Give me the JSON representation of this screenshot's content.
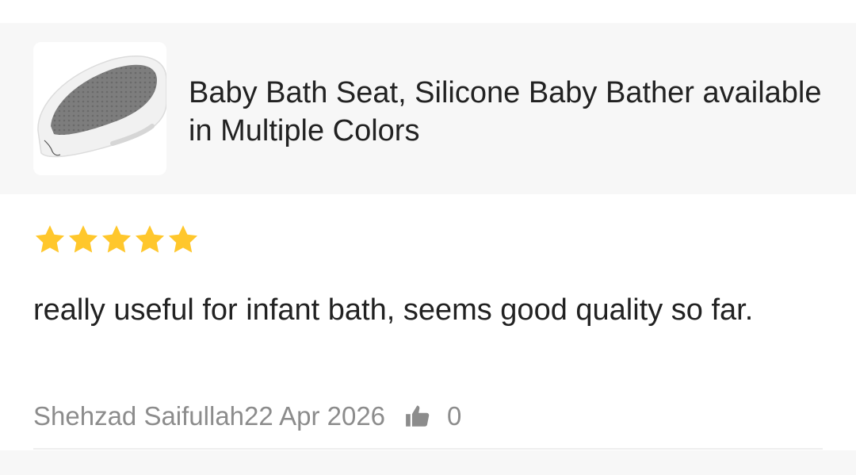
{
  "product": {
    "title": "Baby Bath Seat, Silicone Baby Bather available in Multiple Colors",
    "thumbnail_icon": "baby-bath-seat-image"
  },
  "review": {
    "rating": 5,
    "rating_max": 5,
    "star_color": "#FFC72C",
    "text": "really useful for infant bath, seems good quality so far.",
    "author": "Shehzad Saifullah",
    "date": "22 Apr 2026",
    "like_icon": "thumbs-up-icon",
    "like_count": "0"
  },
  "colors": {
    "card_background": "#F7F7F7",
    "text_primary": "#222222",
    "text_secondary": "#8C8C8C"
  }
}
